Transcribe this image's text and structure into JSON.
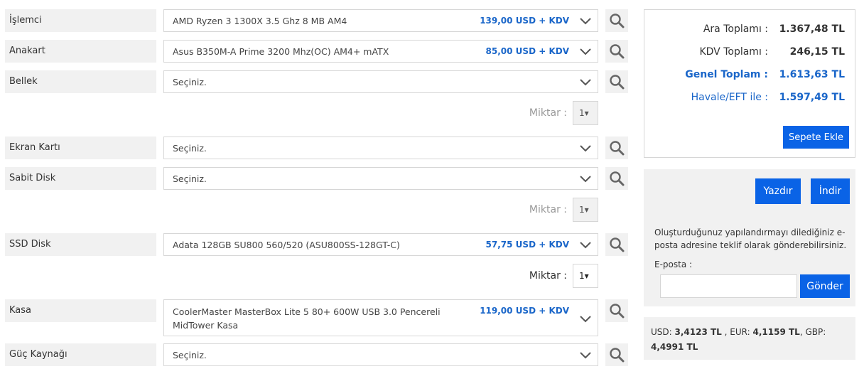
{
  "rows": [
    {
      "label": "İşlemci",
      "value": "AMD Ryzen 3 1300X 3.5 Ghz 8 MB AM4",
      "price": "139,00 USD + KDV"
    },
    {
      "label": "Anakart",
      "value": "Asus B350M-A Prime 3200 Mhz(OC) AM4+ mATX",
      "price": "85,00 USD + KDV"
    },
    {
      "label": "Bellek",
      "value": "Seçiniz.",
      "price": ""
    },
    {
      "label": "Ekran Kartı",
      "value": "Seçiniz.",
      "price": ""
    },
    {
      "label": "Sabit Disk",
      "value": "Seçiniz.",
      "price": ""
    },
    {
      "label": "SSD Disk",
      "value": "Adata 128GB SU800 560/520 (ASU800SS-128GT-C)",
      "price": "57,75 USD + KDV"
    },
    {
      "label": "Kasa",
      "value_line1": "CoolerMaster MasterBox Lite 5 80+ 600W USB 3.0 Pencereli",
      "value_line2": "MidTower Kasa",
      "price": "119,00 USD + KDV"
    },
    {
      "label": "Güç Kaynağı",
      "value": "Seçiniz.",
      "price": ""
    }
  ],
  "quantity": {
    "label": "Miktar :",
    "value": "1▾"
  },
  "summary": {
    "ara_label": "Ara Toplamı :",
    "ara_value": "1.367,48 TL",
    "kdv_label": "KDV Toplamı :",
    "kdv_value": "246,15 TL",
    "genel_label": "Genel Toplam :",
    "genel_value": "1.613,63 TL",
    "havale_label": "Havale/EFT ile :",
    "havale_value": "1.597,49 TL",
    "add_to_cart": "Sepete Ekle"
  },
  "actions": {
    "print": "Yazdır",
    "download": "İndir",
    "email_info_line1": "Oluşturduğunuz yapılandırmayı dilediğiniz e-",
    "email_info_line2": "posta adresine teklif olarak gönderebilirsiniz.",
    "email_label": "E-posta :",
    "email_value": "",
    "send": "Gönder"
  },
  "rates": {
    "usd_label": "USD:",
    "usd_value": "3,4123 TL",
    "eur_label": ", EUR:",
    "eur_value": "4,1159 TL",
    "gbp_label": ", GBP:",
    "gbp_value": "4,4991 TL"
  },
  "colors": {
    "accent": "#0a63e6",
    "price_blue": "#1a66c9",
    "label_bg": "#f1f1f1"
  },
  "icons": {
    "search": "search-icon",
    "dropdown": "chevron-down-icon"
  }
}
